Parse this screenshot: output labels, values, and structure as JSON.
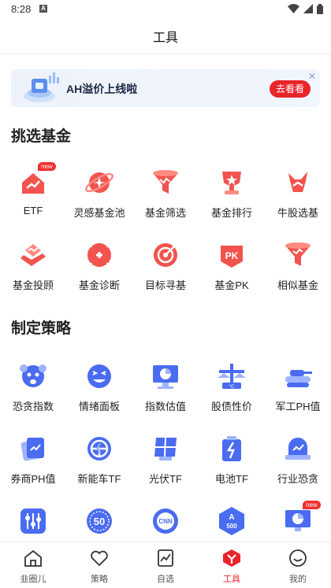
{
  "status": {
    "time": "8:28",
    "a_glyph": "A"
  },
  "header": {
    "title": "工具"
  },
  "banner": {
    "text": "AH溢价上线啦",
    "button": "去看看"
  },
  "sections": {
    "fund": {
      "title": "挑选基金",
      "items": [
        {
          "label": "ETF",
          "icon": "etf-house-icon",
          "badge": "new"
        },
        {
          "label": "灵感基金池",
          "icon": "planet-icon"
        },
        {
          "label": "基金筛选",
          "icon": "funnel-icon"
        },
        {
          "label": "基金排行",
          "icon": "trophy-icon"
        },
        {
          "label": "牛股选基",
          "icon": "bull-icon"
        },
        {
          "label": "基金投顾",
          "icon": "hand-coin-icon"
        },
        {
          "label": "基金诊断",
          "icon": "diagnosis-icon"
        },
        {
          "label": "目标寻基",
          "icon": "target-icon"
        },
        {
          "label": "基金PK",
          "icon": "pk-icon",
          "pk_text": "PK"
        },
        {
          "label": "相似基金",
          "icon": "similar-funnel-icon"
        }
      ]
    },
    "strategy": {
      "title": "制定策略",
      "items": [
        {
          "label": "恐贪指数",
          "icon": "fear-face-icon"
        },
        {
          "label": "情绪面板",
          "icon": "emotion-face-icon"
        },
        {
          "label": "指数估值",
          "icon": "monitor-chart-icon"
        },
        {
          "label": "股债性价",
          "icon": "scale-icon"
        },
        {
          "label": "军工PH值",
          "icon": "tank-icon"
        },
        {
          "label": "券商PH值",
          "icon": "broker-card-icon"
        },
        {
          "label": "新能车TF",
          "icon": "steering-wheel-icon"
        },
        {
          "label": "光伏TF",
          "icon": "solar-panel-icon"
        },
        {
          "label": "电池TF",
          "icon": "battery-icon"
        },
        {
          "label": "行业恐贪",
          "icon": "industry-dome-icon"
        },
        {
          "label": "",
          "icon": "sliders-icon"
        },
        {
          "label": "",
          "icon": "index-50-icon",
          "icon_text": "50"
        },
        {
          "label": "",
          "icon": "cnn-icon",
          "icon_text": "CNN"
        },
        {
          "label": "",
          "icon": "a500-icon",
          "icon_text": "A500"
        },
        {
          "label": "",
          "icon": "monitor-new-icon",
          "badge": "new"
        }
      ]
    }
  },
  "tabbar": {
    "items": [
      {
        "label": "韭圈儿",
        "icon": "home-icon",
        "active": false
      },
      {
        "label": "策略",
        "icon": "heart-icon",
        "active": false
      },
      {
        "label": "自选",
        "icon": "chart-card-icon",
        "active": false
      },
      {
        "label": "工具",
        "icon": "tools-logo-icon",
        "active": true
      },
      {
        "label": "我的",
        "icon": "smile-icon",
        "active": false
      }
    ]
  },
  "colors": {
    "accent": "#e9242b",
    "blue": "#4a6cf0",
    "red_icon": "#f2534e"
  }
}
